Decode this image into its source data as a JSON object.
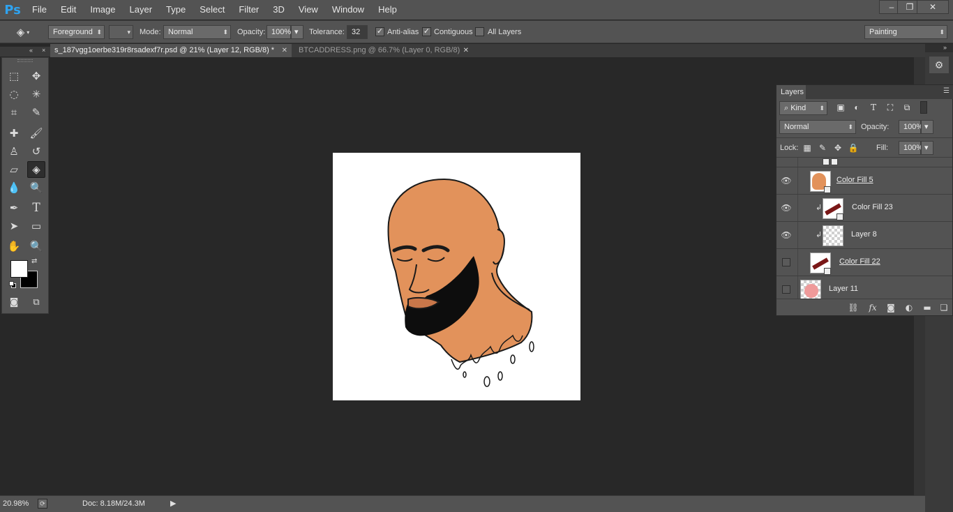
{
  "app": {
    "logo": "Ps"
  },
  "menu": [
    "File",
    "Edit",
    "Image",
    "Layer",
    "Type",
    "Select",
    "Filter",
    "3D",
    "View",
    "Window",
    "Help"
  ],
  "window_controls": {
    "minimize": "–",
    "restore": "❐",
    "close": "✕"
  },
  "options": {
    "fill_source": "Foreground",
    "mode_label": "Mode:",
    "mode": "Normal",
    "opacity_label": "Opacity:",
    "opacity": "100%",
    "tolerance_label": "Tolerance:",
    "tolerance": "32",
    "antialias_label": "Anti-alias",
    "antialias_checked": true,
    "contiguous_label": "Contiguous",
    "contiguous_checked": true,
    "all_layers_label": "All Layers",
    "all_layers_checked": false,
    "workspace": "Painting"
  },
  "tabs": [
    {
      "label": "s_187vgg1oerbe319r8rsadexf7r.psd @ 21% (Layer 12, RGB/8) *",
      "active": true
    },
    {
      "label": "BTCADDRESS.png @ 66.7% (Layer 0, RGB/8)",
      "active": false
    }
  ],
  "tab_close": "✕",
  "tools": [
    "marquee-icon",
    "move-icon",
    "lasso-icon",
    "magic-wand-icon",
    "crop-icon",
    "eyedropper-icon",
    "healing-icon",
    "brush-icon",
    "stamp-icon",
    "history-brush-icon",
    "eraser-icon",
    "paint-bucket-icon",
    "blur-icon",
    "dodge-icon",
    "pen-icon",
    "type-icon",
    "path-select-icon",
    "rectangle-icon",
    "hand-icon",
    "zoom-icon"
  ],
  "tool_glyphs": [
    "⬚",
    "✥",
    "◌",
    "✳",
    "⌗",
    "✎",
    "✚",
    "🖌",
    "♙",
    "↺",
    "▱",
    "◈",
    "💧",
    "🔍",
    "✒",
    "T",
    "➤",
    "▭",
    "✋",
    "🔍"
  ],
  "active_tool": "paint-bucket-icon",
  "colors": {
    "foreground": "#ffffff",
    "background": "#000000",
    "skin": "#e2925b",
    "accent": "#2fa3f0"
  },
  "layers": {
    "tab": "Layers",
    "filter_kind": "Kind",
    "blend_mode": "Normal",
    "opacity_label": "Opacity:",
    "opacity": "100%",
    "lock_label": "Lock:",
    "fill_label": "Fill:",
    "fill": "100%",
    "items": [
      {
        "name": "Color Fill 5",
        "visible": true,
        "clipped": false,
        "linked": true
      },
      {
        "name": "Color Fill 23",
        "visible": true,
        "clipped": true,
        "linked": false
      },
      {
        "name": "Layer 8",
        "visible": true,
        "clipped": true,
        "linked": false
      },
      {
        "name": "Color Fill 22",
        "visible": false,
        "clipped": false,
        "linked": true
      },
      {
        "name": "Layer 11",
        "visible": false,
        "clipped": false,
        "linked": false
      }
    ]
  },
  "status": {
    "zoom": "20.98%",
    "doc": "Doc: 8.18M/24.3M"
  }
}
